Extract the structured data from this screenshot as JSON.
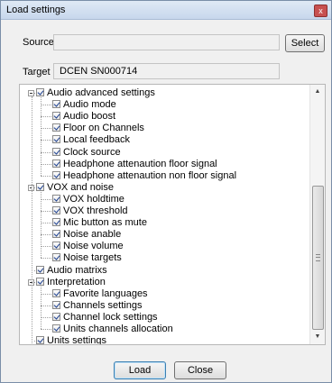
{
  "window": {
    "title": "Load settings",
    "close_glyph": "x"
  },
  "source": {
    "label": "Source",
    "value": "",
    "button": "Select"
  },
  "target": {
    "label": "Target",
    "value": "DCEN SN000714"
  },
  "tree": {
    "items": [
      {
        "label": "Audio advanced settings",
        "level": 1,
        "expander": true,
        "checked": true
      },
      {
        "label": "Audio mode",
        "level": 2,
        "checked": true
      },
      {
        "label": "Audio boost",
        "level": 2,
        "checked": true
      },
      {
        "label": "Floor on Channels",
        "level": 2,
        "checked": true
      },
      {
        "label": "Local feedback",
        "level": 2,
        "checked": true
      },
      {
        "label": "Clock source",
        "level": 2,
        "checked": true
      },
      {
        "label": "Headphone attenaution floor signal",
        "level": 2,
        "checked": true
      },
      {
        "label": "Headphone attenaution non floor signal",
        "level": 2,
        "checked": true
      },
      {
        "label": "VOX and noise",
        "level": 1,
        "expander": true,
        "checked": true
      },
      {
        "label": "VOX holdtime",
        "level": 2,
        "checked": true
      },
      {
        "label": "VOX threshold",
        "level": 2,
        "checked": true
      },
      {
        "label": "Mic button as mute",
        "level": 2,
        "checked": true
      },
      {
        "label": "Noise anable",
        "level": 2,
        "checked": true
      },
      {
        "label": "Noise volume",
        "level": 2,
        "checked": true
      },
      {
        "label": "Noise targets",
        "level": 2,
        "checked": true
      },
      {
        "label": "Audio matrixs",
        "level": 1,
        "expander": false,
        "checked": true
      },
      {
        "label": "Interpretation",
        "level": 1,
        "expander": true,
        "checked": true
      },
      {
        "label": "Favorite languages",
        "level": 2,
        "checked": true
      },
      {
        "label": "Channels settings",
        "level": 2,
        "checked": true
      },
      {
        "label": "Channel lock settings",
        "level": 2,
        "checked": true
      },
      {
        "label": "Units channels allocation",
        "level": 2,
        "checked": true
      },
      {
        "label": "Units settings",
        "level": 1,
        "expander": false,
        "checked": true
      }
    ]
  },
  "scrollbar": {
    "up_glyph": "▲",
    "down_glyph": "▼"
  },
  "buttons": {
    "load": "Load",
    "close": "Close"
  }
}
